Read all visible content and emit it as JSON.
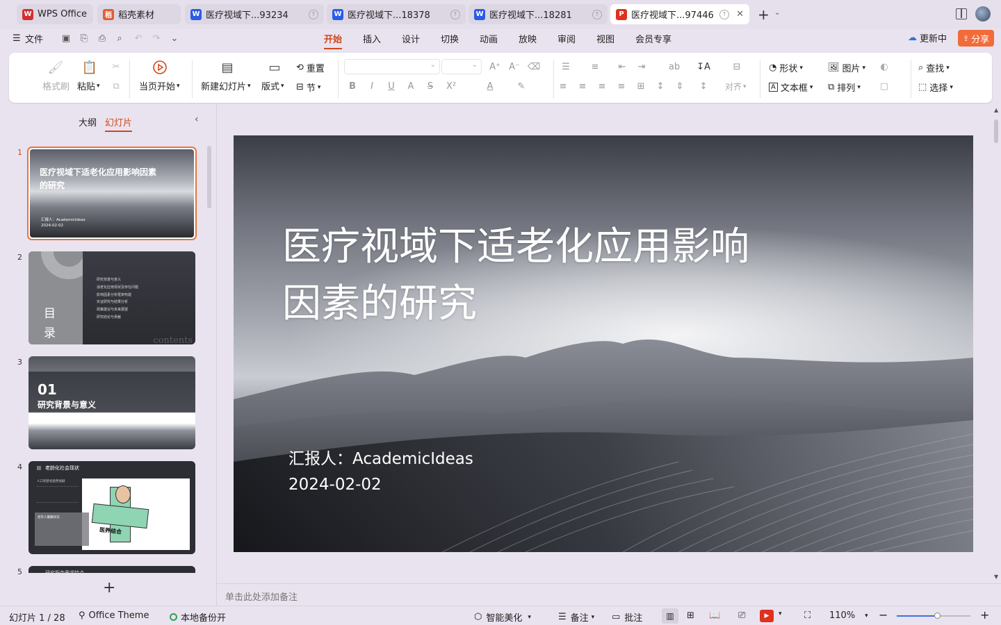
{
  "tabs": [
    {
      "label": "WPS Office",
      "icon": "wps-logo-icon",
      "color": "#d32f2f"
    },
    {
      "label": "稻壳素材",
      "icon": "docer-icon",
      "color": "#e25d33"
    },
    {
      "label": "医疗视域下...93234",
      "icon": "writer-icon",
      "color": "#2b5ce6"
    },
    {
      "label": "医疗视域下...18378",
      "icon": "writer-icon",
      "color": "#2b5ce6"
    },
    {
      "label": "医疗视域下...18281",
      "icon": "writer-icon",
      "color": "#2b5ce6"
    },
    {
      "label": "医疗视域下...97446",
      "icon": "presentation-icon",
      "color": "#e0301e",
      "active": true
    }
  ],
  "menu": {
    "file": "文件",
    "items": [
      "开始",
      "插入",
      "设计",
      "切换",
      "动画",
      "放映",
      "审阅",
      "视图",
      "会员专享"
    ],
    "active": "开始",
    "update": "更新中",
    "share": "分享"
  },
  "ribbon": {
    "format_painter": "格式刷",
    "paste": "粘贴",
    "from_current": "当页开始",
    "new_slide": "新建幻灯片",
    "layout": "版式",
    "reset": "重置",
    "section": "节",
    "align": "对齐",
    "shape": "形状",
    "picture": "图片",
    "textbox": "文本框",
    "arrange": "排列",
    "find": "查找",
    "select": "选择"
  },
  "panel": {
    "outline_tab": "大纲",
    "slides_tab": "幻灯片",
    "active": "幻灯片"
  },
  "thumbnails": [
    {
      "num": "1",
      "title": "医疗视域下适老化应用影响因素的研究",
      "reporter": "汇报人：AcademicIdeas",
      "date": "2024-02-02"
    },
    {
      "num": "2",
      "heading": "目录",
      "watermark": "contents",
      "items": [
        "研究背景与意义",
        "适老化应用现状及存在问题",
        "影响因素分析框架构建",
        "实证研究与结果分析",
        "政策建议与未来展望",
        "研究结论与贡献"
      ]
    },
    {
      "num": "3",
      "number": "01",
      "title": "研究背景与意义"
    },
    {
      "num": "4",
      "title": "老龄化社会现状",
      "subtitle": "人口老龄化趋势加剧",
      "box_title": "老年人健康状况",
      "label": "医养结合"
    },
    {
      "num": "5",
      "title": "研究服务需求特点"
    }
  ],
  "slide": {
    "title_line1": "医疗视域下适老化应用影响",
    "title_line2": "因素的研究",
    "reporter": "汇报人：AcademicIdeas",
    "date": "2024-02-02"
  },
  "notes_placeholder": "单击此处添加备注",
  "status": {
    "slide_count": "幻灯片 1 / 28",
    "theme": "Office Theme",
    "backup": "本地备份开",
    "beautify": "智能美化",
    "notes": "备注",
    "comments": "批注",
    "zoom": "110%",
    "zoom_level": 0.55
  },
  "colors": {
    "accent": "#d2461b",
    "share_bg": "#f26b3a",
    "zoom_slider": "#3f6fe5"
  }
}
